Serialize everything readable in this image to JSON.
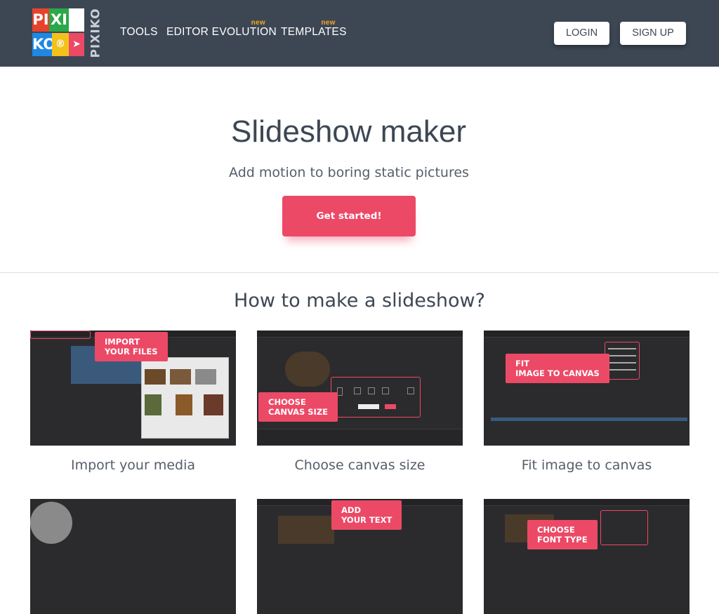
{
  "brand": {
    "logo_letters": [
      "PI",
      "XI",
      "KO",
      "®"
    ],
    "logo_word": "PIXIKO"
  },
  "nav": {
    "tools": "TOOLS",
    "editor_evolution": "EDITOR EVOLUTION",
    "editor_badge": "new",
    "templates": "TEMPLATES",
    "templates_badge": "new"
  },
  "auth": {
    "login": "LOGIN",
    "signup": "SIGN UP"
  },
  "hero": {
    "title": "Slideshow maker",
    "subtitle": "Add motion to boring static pictures",
    "cta": "Get started!"
  },
  "section": {
    "title": "How to make a slideshow?"
  },
  "steps": [
    {
      "callout_1": "IMPORT",
      "callout_2": "YOUR FILES",
      "caption": "Import your media"
    },
    {
      "callout_1": "CHOOSE",
      "callout_2": "CANVAS SIZE",
      "caption": "Choose canvas size"
    },
    {
      "callout_1": "FIT",
      "callout_2": "IMAGE TO CANVAS",
      "caption": "Fit image to canvas"
    },
    {
      "callout_1": "",
      "callout_2": "",
      "caption": ""
    },
    {
      "callout_1": "ADD",
      "callout_2": "YOUR TEXT",
      "caption": ""
    },
    {
      "callout_1": "CHOOSE",
      "callout_2": "FONT TYPE",
      "caption": ""
    }
  ],
  "colors": {
    "header_bg": "#3d4754",
    "accent": "#ec4966",
    "badge": "#f5a623"
  }
}
